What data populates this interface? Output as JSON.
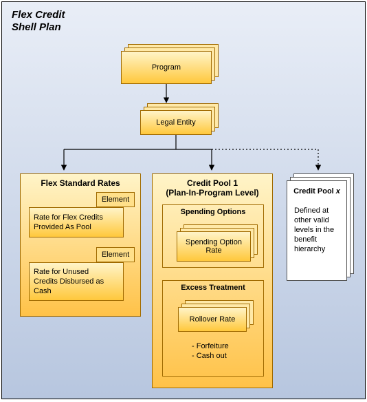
{
  "title": "Flex Credit\nShell Plan",
  "nodes": {
    "program": "Program",
    "legal_entity": "Legal Entity"
  },
  "panels": {
    "flex_rates": {
      "title": "Flex Standard Rates",
      "element_label": "Element",
      "rate_pool": "Rate for Flex Credits\nProvided As Pool",
      "rate_unused": "Rate for Unused\nCredits Disbursed as\nCash"
    },
    "credit_pool_1": {
      "title": "Credit Pool 1\n(Plan-In-Program Level)",
      "spending": {
        "title": "Spending Options",
        "rate": "Spending Option\nRate"
      },
      "excess": {
        "title": "Excess Treatment",
        "rollover": "Rollover Rate",
        "bullets": "- Forfeiture\n- Cash out"
      }
    },
    "credit_pool_x": {
      "title": "Credit Pool ",
      "title_italic": "x",
      "body": "Defined at\nother valid\nlevels in the\nbenefit\nhierarchy"
    }
  },
  "chart_data": {
    "type": "diagram",
    "description": "Hierarchy diagram of a Flex Credit Shell Plan showing a Program containing a Legal Entity which branches to Flex Standard Rates, Credit Pool 1, and (via dotted line) additional Credit Pools.",
    "nodes": [
      {
        "id": "program",
        "label": "Program",
        "stacked": true
      },
      {
        "id": "legal_entity",
        "label": "Legal Entity",
        "stacked": true
      },
      {
        "id": "flex_rates",
        "label": "Flex Standard Rates",
        "children": [
          {
            "id": "element_1",
            "label": "Element"
          },
          {
            "id": "rate_pool",
            "label": "Rate for Flex Credits Provided As Pool"
          },
          {
            "id": "element_2",
            "label": "Element"
          },
          {
            "id": "rate_unused",
            "label": "Rate for Unused Credits Disbursed as Cash"
          }
        ]
      },
      {
        "id": "credit_pool_1",
        "label": "Credit Pool 1 (Plan-In-Program Level)",
        "children": [
          {
            "id": "spending_options",
            "label": "Spending Options",
            "children": [
              {
                "id": "spending_option_rate",
                "label": "Spending Option Rate",
                "stacked": true
              }
            ]
          },
          {
            "id": "excess_treatment",
            "label": "Excess Treatment",
            "children": [
              {
                "id": "rollover_rate",
                "label": "Rollover Rate",
                "stacked": true
              },
              {
                "id": "excess_bullets",
                "label": "- Forfeiture\n- Cash out"
              }
            ]
          }
        ]
      },
      {
        "id": "credit_pool_x",
        "label": "Credit Pool x",
        "body": "Defined at other valid levels in the benefit hierarchy",
        "stacked": true
      }
    ],
    "edges": [
      {
        "from": "program",
        "to": "legal_entity",
        "style": "solid"
      },
      {
        "from": "legal_entity",
        "to": "flex_rates",
        "style": "solid"
      },
      {
        "from": "legal_entity",
        "to": "credit_pool_1",
        "style": "solid"
      },
      {
        "from": "legal_entity",
        "to": "credit_pool_x",
        "style": "dotted"
      }
    ]
  }
}
